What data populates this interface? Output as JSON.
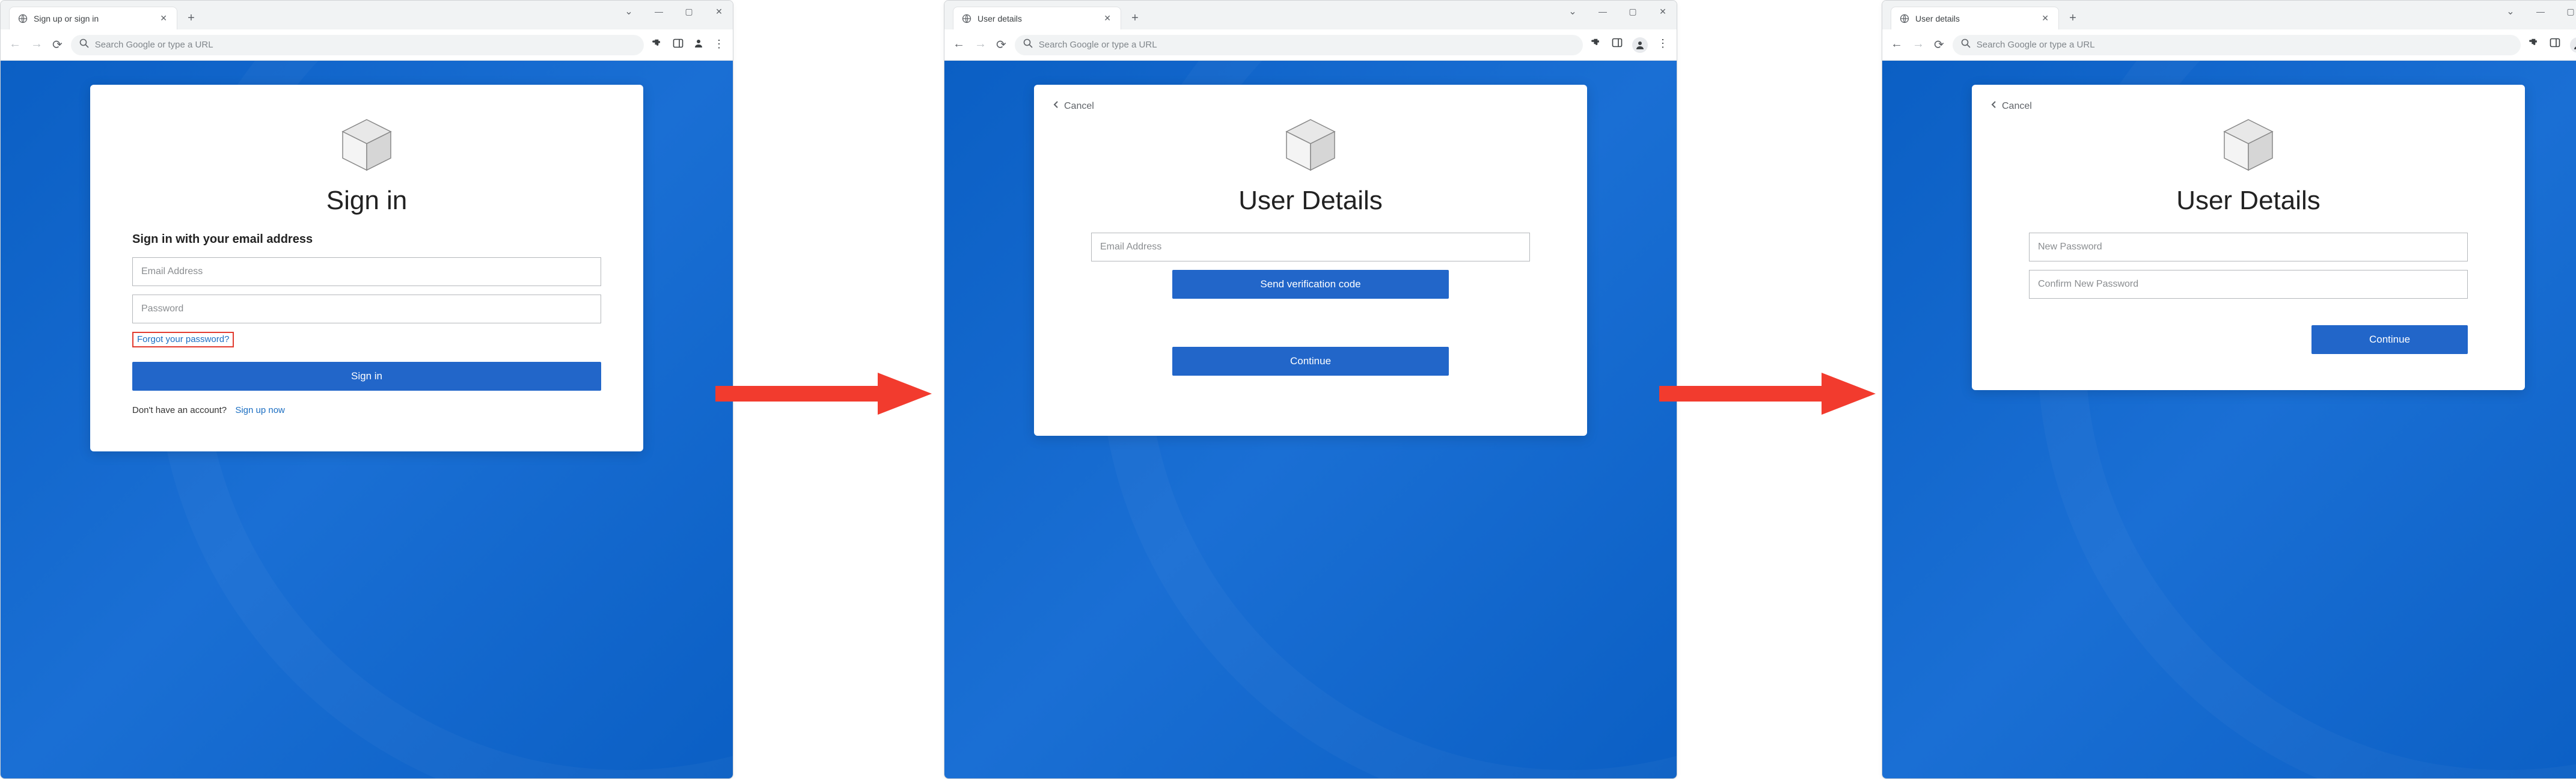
{
  "screens": [
    {
      "tab_title": "Sign up or sign in",
      "omnibox_placeholder": "Search Google or type a URL",
      "card": {
        "heading": "Sign in",
        "subtitle": "Sign in with your email address",
        "email_placeholder": "Email Address",
        "password_placeholder": "Password",
        "forgot_label": "Forgot your password?",
        "signin_button": "Sign in",
        "no_account_text": "Don't have an account?",
        "signup_link": "Sign up now"
      }
    },
    {
      "tab_title": "User details",
      "omnibox_placeholder": "Search Google or type a URL",
      "card": {
        "cancel_label": "Cancel",
        "heading": "User Details",
        "email_placeholder": "Email Address",
        "send_code_button": "Send verification code",
        "continue_button": "Continue"
      }
    },
    {
      "tab_title": "User details",
      "omnibox_placeholder": "Search Google or type a URL",
      "card": {
        "cancel_label": "Cancel",
        "heading": "User Details",
        "newpw_placeholder": "New Password",
        "confirmpw_placeholder": "Confirm New Password",
        "continue_button": "Continue"
      }
    }
  ]
}
